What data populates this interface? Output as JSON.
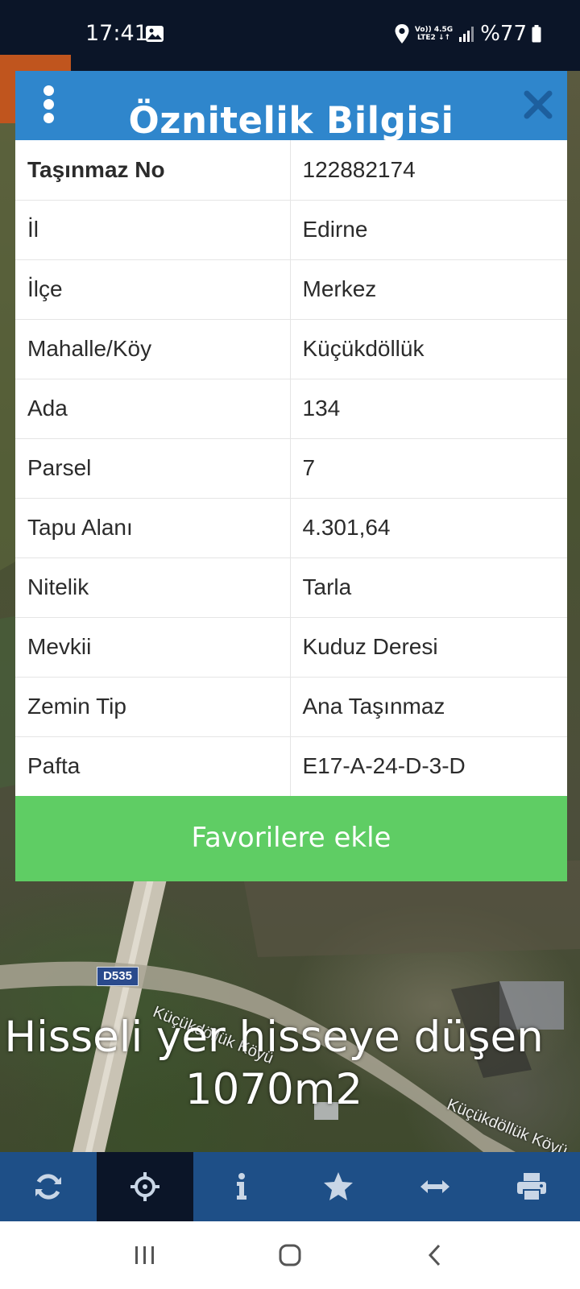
{
  "status_bar": {
    "time": "17:41",
    "network_top": "Vo)) 4.5G",
    "network_bottom": "LTE2 ↓↑",
    "battery": "%77"
  },
  "dialog": {
    "title": "Öznitelik Bilgisi",
    "rows": [
      {
        "key": "Taşınmaz No",
        "value": "122882174"
      },
      {
        "key": "İl",
        "value": "Edirne"
      },
      {
        "key": "İlçe",
        "value": "Merkez"
      },
      {
        "key": "Mahalle/Köy",
        "value": "Küçükdöllük"
      },
      {
        "key": "Ada",
        "value": "134"
      },
      {
        "key": "Parsel",
        "value": "7"
      },
      {
        "key": "Tapu Alanı",
        "value": "4.301,64"
      },
      {
        "key": "Nitelik",
        "value": "Tarla"
      },
      {
        "key": "Mevkii",
        "value": "Kuduz Deresi"
      },
      {
        "key": "Zemin Tip",
        "value": "Ana Taşınmaz"
      },
      {
        "key": "Pafta",
        "value": "E17-A-24-D-3-D"
      }
    ],
    "favorite_button": "Favorilere ekle"
  },
  "map": {
    "road_label": "D535",
    "street_label_1": "Küçükdöllük Köyü",
    "street_label_2": "Küçükdöllük Köyü",
    "overlay_line1": "Hisseli yer hisseye düşen",
    "overlay_line2": "1070m2"
  },
  "toolbar": {
    "items": [
      "refresh-icon",
      "crosshair-icon",
      "info-icon",
      "star-icon",
      "measure-icon",
      "print-icon"
    ],
    "active_index": 1
  },
  "colors": {
    "header_blue": "#2f86cc",
    "favorite_green": "#5fcd64",
    "toolbar_blue": "#1e4f87",
    "status_bar": "#0b1528"
  }
}
